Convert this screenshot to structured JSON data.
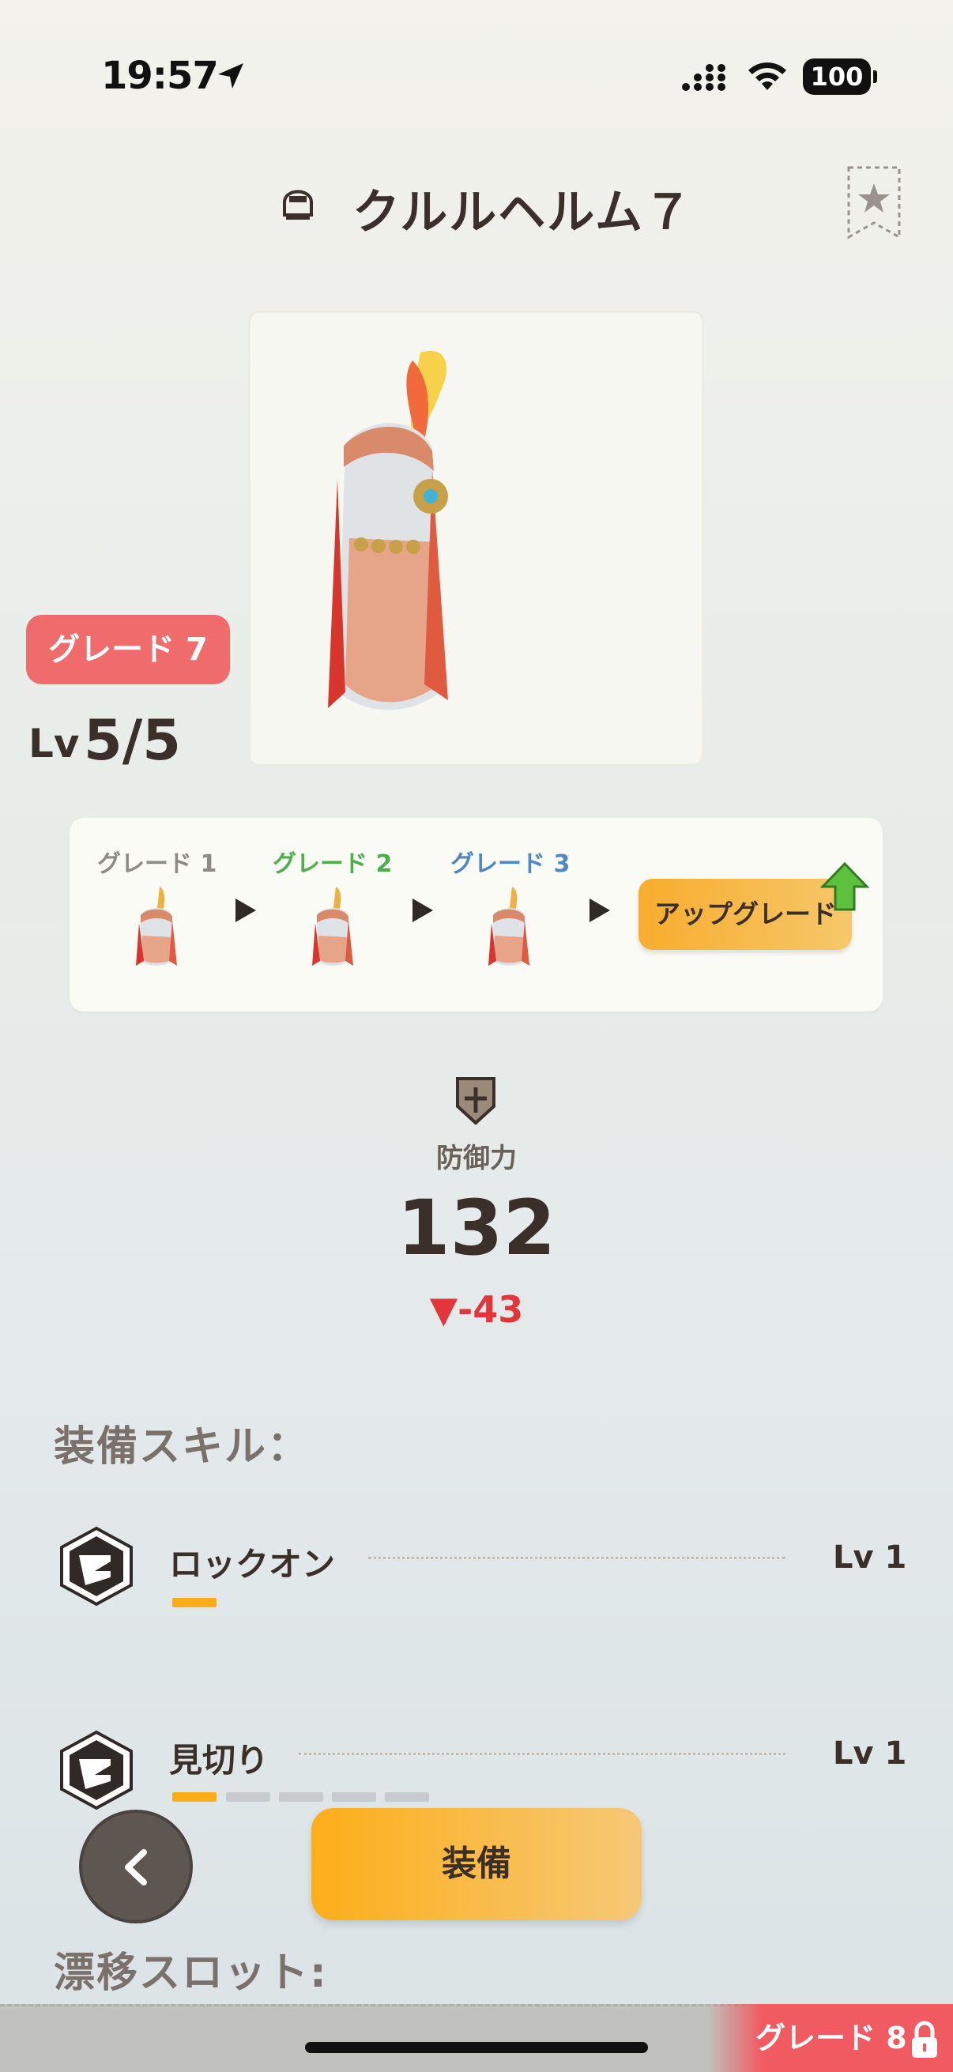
{
  "status_bar": {
    "time": "19:57",
    "battery": "100"
  },
  "header": {
    "title": "クルルヘルム７"
  },
  "item": {
    "grade_label": "グレード 7",
    "level_prefix": "Lv",
    "level_value": "5/5"
  },
  "grade_strip": {
    "grades": [
      {
        "label": "グレード 1",
        "color": "#8e8a86"
      },
      {
        "label": "グレード 2",
        "color": "#4fae4c"
      },
      {
        "label": "グレード 3",
        "color": "#4f86c4"
      }
    ],
    "upgrade_label": "アップグレード"
  },
  "stats": {
    "defense_label": "防御力",
    "defense_value": "132",
    "defense_delta": "▼-43",
    "delta_color": "#e2363a"
  },
  "skills_section": {
    "title": "装備スキル：",
    "skills": [
      {
        "name": "ロックオン",
        "level": "Lv 1",
        "segments_filled": 1,
        "segments_total": 1
      },
      {
        "name": "見切り",
        "level": "Lv 1",
        "segments_filled": 1,
        "segments_total": 5
      }
    ]
  },
  "actions": {
    "back_icon": "chevron-left",
    "equip_label": "装備"
  },
  "drift_section": {
    "title": "漂移スロット:"
  },
  "bottom": {
    "next_grade_label": "グレード 8"
  },
  "colors": {
    "accent_orange": "#fdae1a",
    "grade_red": "#f06c6c"
  }
}
